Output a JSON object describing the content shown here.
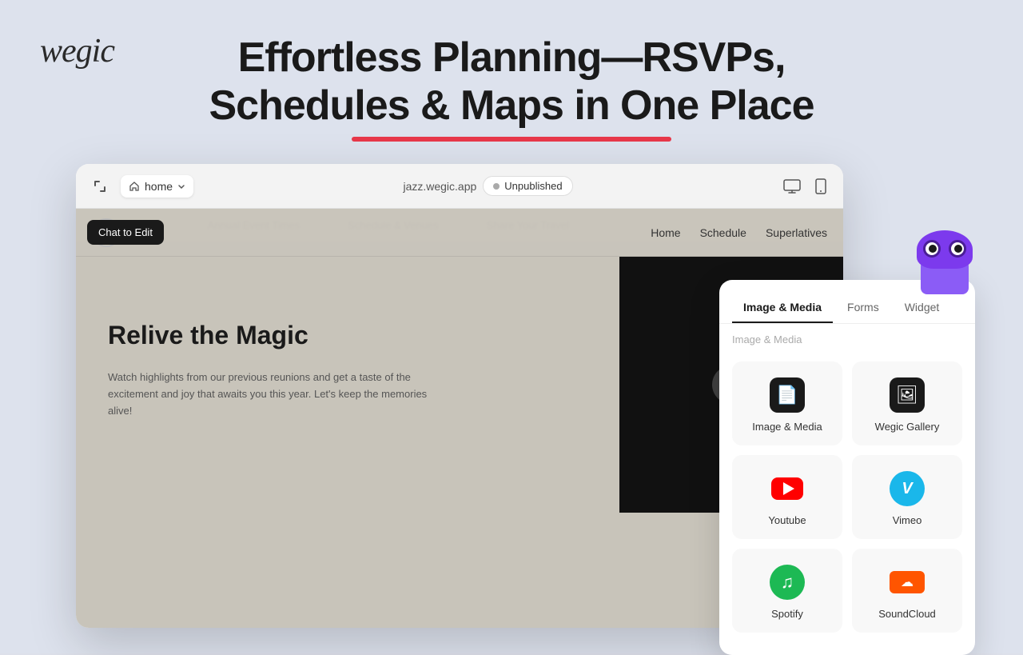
{
  "page": {
    "background_color": "#dde2ed"
  },
  "logo": {
    "text": "wegic"
  },
  "headline": {
    "line1": "Effortless Planning—RSVPs,",
    "line2": "Schedules & Maps in One Place"
  },
  "browser": {
    "home_tab_label": "home",
    "url": "jazz.wegic.app",
    "status_label": "Unpublished",
    "chat_button_label": "Chat to Edit",
    "nav_links": [
      "Home",
      "Schedule",
      "Superlatives"
    ],
    "page_title": "Relive the Magic",
    "page_description": "Watch highlights from our previous reunions and get a taste of the excitement and joy that awaits you this year. Let's keep the memories alive!"
  },
  "panel": {
    "tabs": [
      {
        "label": "Image & Media",
        "active": true
      },
      {
        "label": "Forms",
        "active": false
      },
      {
        "label": "Widget",
        "active": false
      }
    ],
    "section_label": "Image & Media",
    "items": [
      {
        "id": "image-media",
        "label": "Image & Media",
        "icon_type": "image-media"
      },
      {
        "id": "wegic-gallery",
        "label": "Wegic Gallery",
        "icon_type": "gallery"
      },
      {
        "id": "youtube",
        "label": "Youtube",
        "icon_type": "youtube"
      },
      {
        "id": "vimeo",
        "label": "Vimeo",
        "icon_type": "vimeo"
      },
      {
        "id": "spotify",
        "label": "Spotify",
        "icon_type": "spotify"
      },
      {
        "id": "soundcloud",
        "label": "SoundCloud",
        "icon_type": "soundcloud"
      }
    ]
  }
}
